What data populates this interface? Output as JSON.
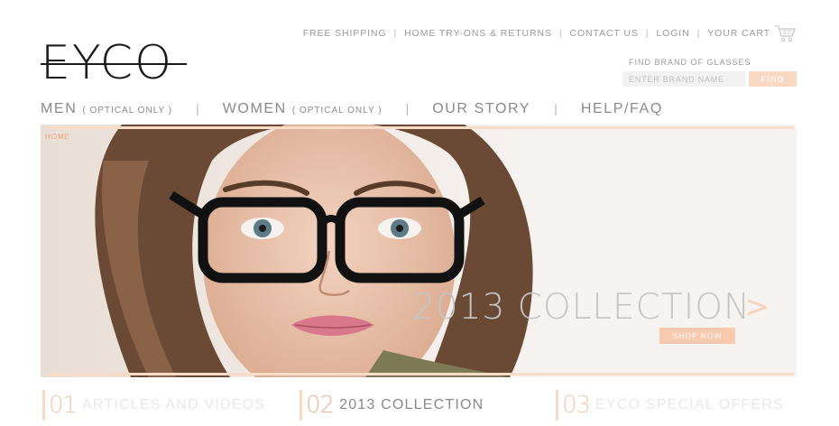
{
  "top_nav": {
    "free_shipping": "FREE SHIPPING",
    "try_ons": "HOME TRY-ONS & RETURNS",
    "contact": "CONTACT US",
    "login": "LOGIN",
    "cart": "YOUR CART",
    "separator": "|",
    "cart_icon": "shopping-cart-icon"
  },
  "logo": {
    "text": "EYCO"
  },
  "finder": {
    "label": "FIND BRAND OF GLASSES",
    "placeholder": "ENTER BRAND NAME",
    "button": "FIND"
  },
  "main_nav": {
    "items": [
      {
        "label": "MEN",
        "sub": "( OPTICAL ONLY )"
      },
      {
        "label": "WOMEN",
        "sub": "( OPTICAL ONLY )"
      },
      {
        "label": "OUR STORY"
      },
      {
        "label": "HELP/FAQ"
      }
    ],
    "separator": "|"
  },
  "breadcrumb": "HOME",
  "hero": {
    "title": "2013 COLLECTION",
    "arrow": ">",
    "cta": "SHOP NOW"
  },
  "tabs": [
    {
      "num": "01",
      "label": "ARTICLES AND VIDEOS",
      "active": false
    },
    {
      "num": "02",
      "label": "2013 COLLECTION",
      "active": true
    },
    {
      "num": "03",
      "label": "EYCO SPECIAL OFFERS",
      "active": false
    }
  ],
  "colors": {
    "accent": "#f9d9c4",
    "accent_dark": "#f0b592",
    "text": "#8a8a8a",
    "logo": "#1a1a1a"
  }
}
